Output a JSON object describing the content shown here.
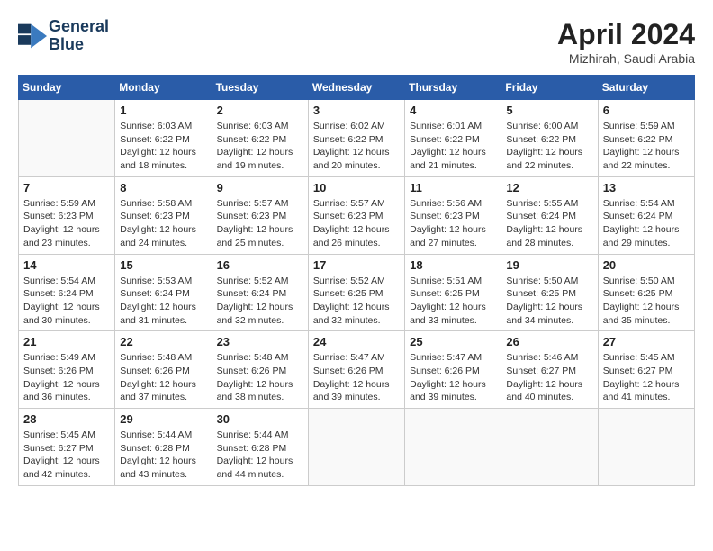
{
  "header": {
    "logo_line1": "General",
    "logo_line2": "Blue",
    "month": "April 2024",
    "location": "Mizhirah, Saudi Arabia"
  },
  "days_of_week": [
    "Sunday",
    "Monday",
    "Tuesday",
    "Wednesday",
    "Thursday",
    "Friday",
    "Saturday"
  ],
  "weeks": [
    [
      {
        "day": "",
        "info": ""
      },
      {
        "day": "1",
        "info": "Sunrise: 6:03 AM\nSunset: 6:22 PM\nDaylight: 12 hours\nand 18 minutes."
      },
      {
        "day": "2",
        "info": "Sunrise: 6:03 AM\nSunset: 6:22 PM\nDaylight: 12 hours\nand 19 minutes."
      },
      {
        "day": "3",
        "info": "Sunrise: 6:02 AM\nSunset: 6:22 PM\nDaylight: 12 hours\nand 20 minutes."
      },
      {
        "day": "4",
        "info": "Sunrise: 6:01 AM\nSunset: 6:22 PM\nDaylight: 12 hours\nand 21 minutes."
      },
      {
        "day": "5",
        "info": "Sunrise: 6:00 AM\nSunset: 6:22 PM\nDaylight: 12 hours\nand 22 minutes."
      },
      {
        "day": "6",
        "info": "Sunrise: 5:59 AM\nSunset: 6:22 PM\nDaylight: 12 hours\nand 22 minutes."
      }
    ],
    [
      {
        "day": "7",
        "info": "Sunrise: 5:59 AM\nSunset: 6:23 PM\nDaylight: 12 hours\nand 23 minutes."
      },
      {
        "day": "8",
        "info": "Sunrise: 5:58 AM\nSunset: 6:23 PM\nDaylight: 12 hours\nand 24 minutes."
      },
      {
        "day": "9",
        "info": "Sunrise: 5:57 AM\nSunset: 6:23 PM\nDaylight: 12 hours\nand 25 minutes."
      },
      {
        "day": "10",
        "info": "Sunrise: 5:57 AM\nSunset: 6:23 PM\nDaylight: 12 hours\nand 26 minutes."
      },
      {
        "day": "11",
        "info": "Sunrise: 5:56 AM\nSunset: 6:23 PM\nDaylight: 12 hours\nand 27 minutes."
      },
      {
        "day": "12",
        "info": "Sunrise: 5:55 AM\nSunset: 6:24 PM\nDaylight: 12 hours\nand 28 minutes."
      },
      {
        "day": "13",
        "info": "Sunrise: 5:54 AM\nSunset: 6:24 PM\nDaylight: 12 hours\nand 29 minutes."
      }
    ],
    [
      {
        "day": "14",
        "info": "Sunrise: 5:54 AM\nSunset: 6:24 PM\nDaylight: 12 hours\nand 30 minutes."
      },
      {
        "day": "15",
        "info": "Sunrise: 5:53 AM\nSunset: 6:24 PM\nDaylight: 12 hours\nand 31 minutes."
      },
      {
        "day": "16",
        "info": "Sunrise: 5:52 AM\nSunset: 6:24 PM\nDaylight: 12 hours\nand 32 minutes."
      },
      {
        "day": "17",
        "info": "Sunrise: 5:52 AM\nSunset: 6:25 PM\nDaylight: 12 hours\nand 32 minutes."
      },
      {
        "day": "18",
        "info": "Sunrise: 5:51 AM\nSunset: 6:25 PM\nDaylight: 12 hours\nand 33 minutes."
      },
      {
        "day": "19",
        "info": "Sunrise: 5:50 AM\nSunset: 6:25 PM\nDaylight: 12 hours\nand 34 minutes."
      },
      {
        "day": "20",
        "info": "Sunrise: 5:50 AM\nSunset: 6:25 PM\nDaylight: 12 hours\nand 35 minutes."
      }
    ],
    [
      {
        "day": "21",
        "info": "Sunrise: 5:49 AM\nSunset: 6:26 PM\nDaylight: 12 hours\nand 36 minutes."
      },
      {
        "day": "22",
        "info": "Sunrise: 5:48 AM\nSunset: 6:26 PM\nDaylight: 12 hours\nand 37 minutes."
      },
      {
        "day": "23",
        "info": "Sunrise: 5:48 AM\nSunset: 6:26 PM\nDaylight: 12 hours\nand 38 minutes."
      },
      {
        "day": "24",
        "info": "Sunrise: 5:47 AM\nSunset: 6:26 PM\nDaylight: 12 hours\nand 39 minutes."
      },
      {
        "day": "25",
        "info": "Sunrise: 5:47 AM\nSunset: 6:26 PM\nDaylight: 12 hours\nand 39 minutes."
      },
      {
        "day": "26",
        "info": "Sunrise: 5:46 AM\nSunset: 6:27 PM\nDaylight: 12 hours\nand 40 minutes."
      },
      {
        "day": "27",
        "info": "Sunrise: 5:45 AM\nSunset: 6:27 PM\nDaylight: 12 hours\nand 41 minutes."
      }
    ],
    [
      {
        "day": "28",
        "info": "Sunrise: 5:45 AM\nSunset: 6:27 PM\nDaylight: 12 hours\nand 42 minutes."
      },
      {
        "day": "29",
        "info": "Sunrise: 5:44 AM\nSunset: 6:28 PM\nDaylight: 12 hours\nand 43 minutes."
      },
      {
        "day": "30",
        "info": "Sunrise: 5:44 AM\nSunset: 6:28 PM\nDaylight: 12 hours\nand 44 minutes."
      },
      {
        "day": "",
        "info": ""
      },
      {
        "day": "",
        "info": ""
      },
      {
        "day": "",
        "info": ""
      },
      {
        "day": "",
        "info": ""
      }
    ]
  ]
}
